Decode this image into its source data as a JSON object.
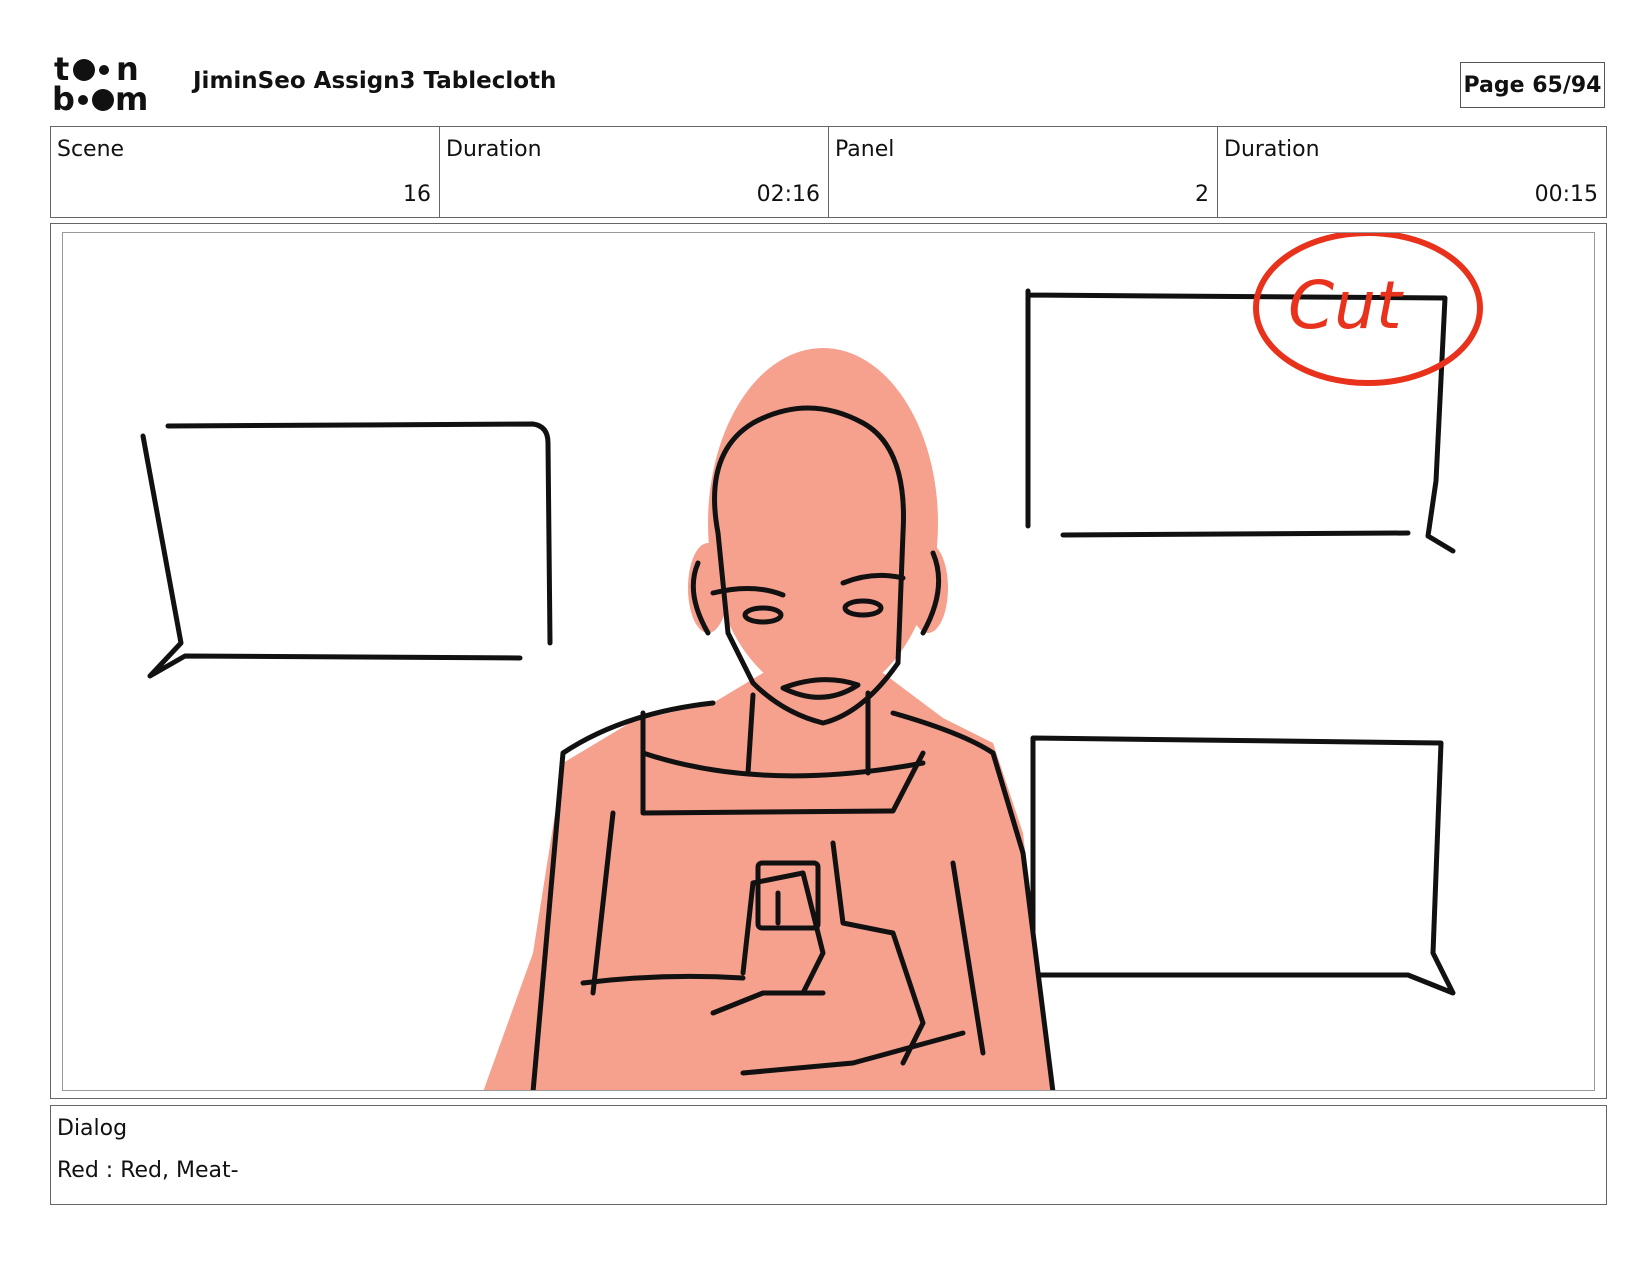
{
  "header": {
    "logo_text": "toon boom",
    "title": "JiminSeo Assign3 Tablecloth",
    "page": "Page 65/94"
  },
  "info": {
    "scene_label": "Scene",
    "scene_value": "16",
    "scene_duration_label": "Duration",
    "scene_duration_value": "02:16",
    "panel_label": "Panel",
    "panel_value": "2",
    "panel_duration_label": "Duration",
    "panel_duration_value": "00:15"
  },
  "panel": {
    "annotation": "Cut",
    "annotation_color": "#e8321c",
    "character_color": "#f6a08e"
  },
  "dialog": {
    "label": "Dialog",
    "text": "Red : Red, Meat-"
  }
}
